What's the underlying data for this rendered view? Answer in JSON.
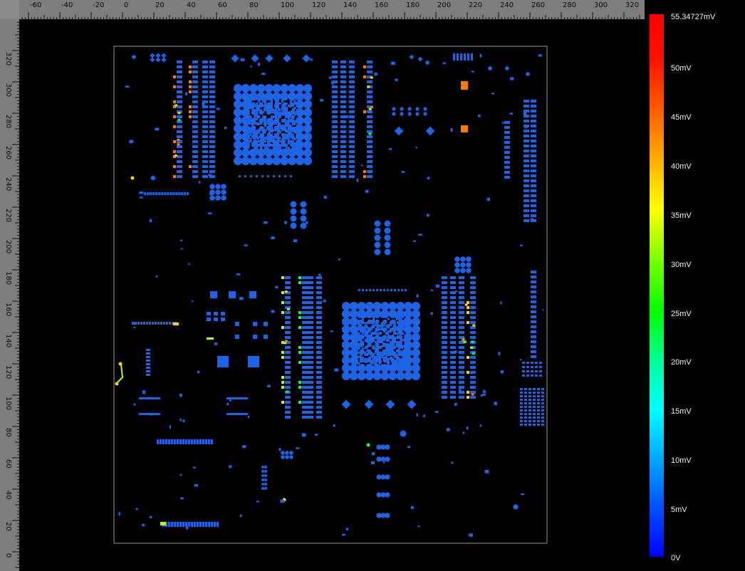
{
  "rulers": {
    "top_labels": [
      "-60",
      "-40",
      "-20",
      "0",
      "20",
      "40",
      "60",
      "80",
      "100",
      "120",
      "140",
      "160",
      "180",
      "200",
      "220",
      "240",
      "260",
      "280",
      "300",
      "320"
    ],
    "left_labels": [
      "320",
      "300",
      "280",
      "260",
      "240",
      "220",
      "200",
      "180",
      "160",
      "140",
      "120",
      "100",
      "80",
      "60",
      "40",
      "20",
      "0"
    ]
  },
  "legend": {
    "max_label": "55.34727mV",
    "labels": [
      "50mV",
      "45mV",
      "40mV",
      "35mV",
      "30mV",
      "25mV",
      "20mV",
      "15mV",
      "10mV",
      "5mV",
      "0V"
    ],
    "colors": {
      "min": "#0000ff",
      "max": "#ff0000"
    }
  },
  "board": {
    "outline_color": "#9a9a9a",
    "pad_color": "#1e64e6",
    "hot_colors": [
      "#ff7a00",
      "#ffd400",
      "#b6ff00",
      "#00ff60"
    ]
  }
}
